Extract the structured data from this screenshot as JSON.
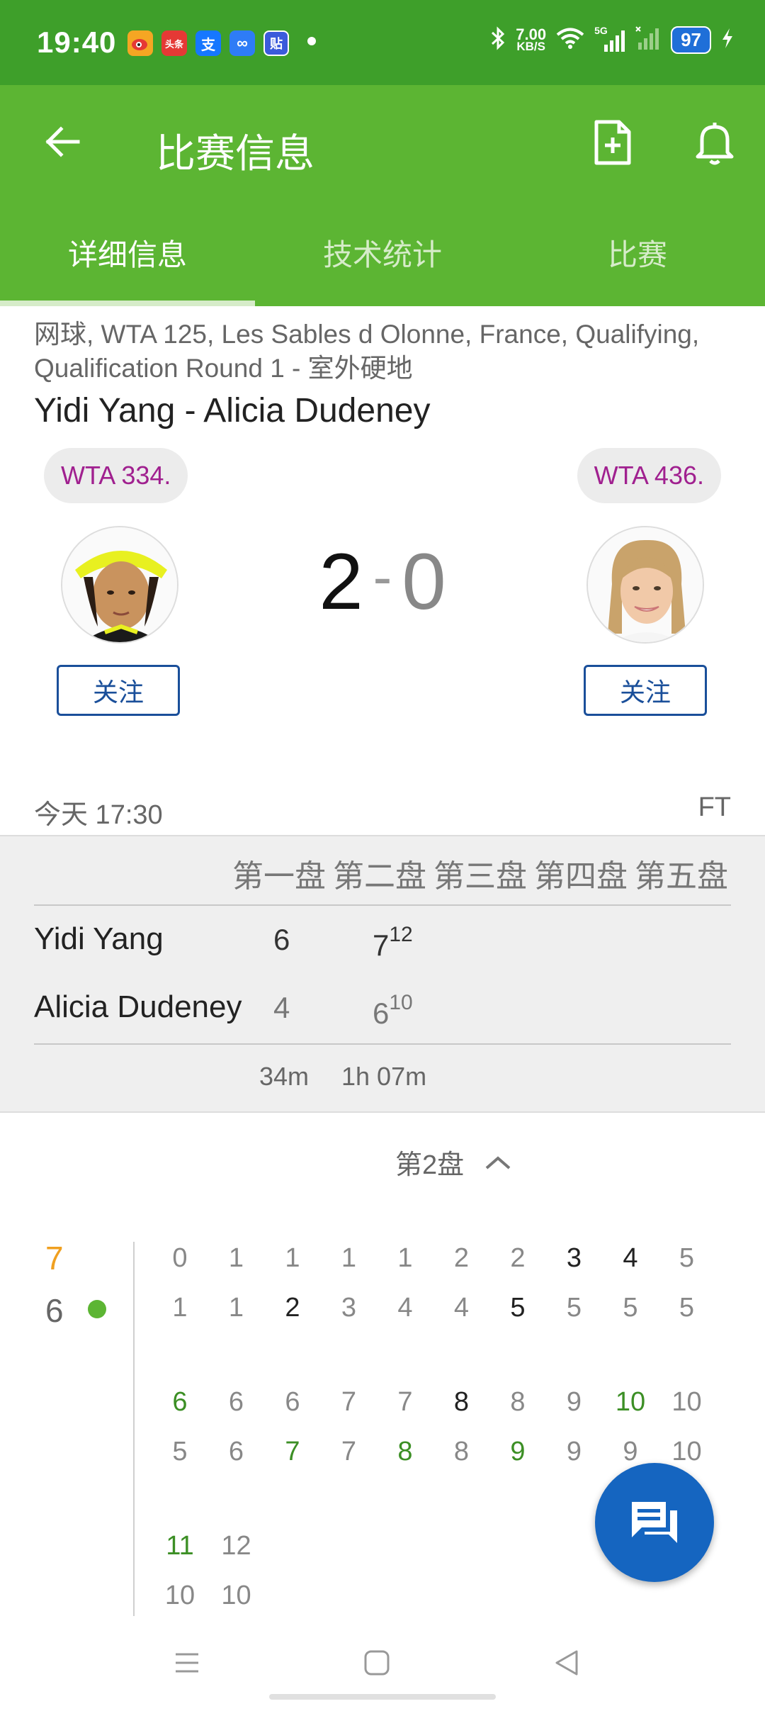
{
  "status_bar": {
    "time": "19:40",
    "net_speed_value": "7.00",
    "net_speed_unit": "KB/S",
    "network": "5G",
    "battery": "97",
    "apps": [
      {
        "name": "weibo-icon",
        "label": "",
        "color": "#f5a623"
      },
      {
        "name": "toutiao-icon",
        "label": "头条",
        "color": "#e53935"
      },
      {
        "name": "alipay-icon",
        "label": "支",
        "color": "#1677ff"
      },
      {
        "name": "baidu-netdisk-icon",
        "label": "∞",
        "color": "#2e7cf6"
      },
      {
        "name": "tieba-icon",
        "label": "贴",
        "color": "#3b5bdb"
      }
    ]
  },
  "app_bar": {
    "title": "比赛信息",
    "back_icon": "arrow-left-icon",
    "actions": [
      "add-document-icon",
      "bell-icon"
    ]
  },
  "tabs": [
    {
      "label": "详细信息",
      "active": true
    },
    {
      "label": "技术统计",
      "active": false
    },
    {
      "label": "比赛",
      "active": false
    }
  ],
  "match": {
    "league": "网球, WTA 125, Les Sables d Olonne, France, Qualifying, Qualification Round 1 - 室外硬地",
    "title": "Yidi Yang - Alicia Dudeney",
    "home": {
      "name": "Yidi Yang",
      "rank": "WTA 334.",
      "follow": "关注"
    },
    "away": {
      "name": "Alicia Dudeney",
      "rank": "WTA 436.",
      "follow": "关注"
    },
    "score_home": "2",
    "score_sep": "-",
    "score_away": "0",
    "datetime": "今天 17:30",
    "status": "FT"
  },
  "sets_table": {
    "headers": [
      "第一盘",
      "第二盘",
      "第三盘",
      "第四盘",
      "第五盘"
    ],
    "rows": [
      {
        "player": "Yidi Yang",
        "set1": "6",
        "set2": "7",
        "set2_tb": "12"
      },
      {
        "player": "Alicia Dudeney",
        "set1": "4",
        "set2": "6",
        "set2_tb": "10"
      }
    ],
    "durations": [
      "34m",
      "1h 07m"
    ]
  },
  "set_detail": {
    "label": "第2盘",
    "chevron": "chevron-up-icon",
    "home_games": "7",
    "away_games": "6",
    "home_color": "#f0a020",
    "serve_color": "#5cb533",
    "progression": [
      {
        "home": [
          "0",
          "1",
          "1",
          "1",
          "1",
          "2",
          "2",
          "3",
          "4",
          "5"
        ],
        "away": [
          "1",
          "1",
          "2",
          "3",
          "4",
          "4",
          "5",
          "5",
          "5",
          "5"
        ]
      },
      {
        "home": [
          "6",
          "6",
          "6",
          "7",
          "7",
          "8",
          "8",
          "9",
          "10",
          "10"
        ],
        "away": [
          "5",
          "6",
          "7",
          "7",
          "8",
          "8",
          "9",
          "9",
          "9",
          "10"
        ]
      },
      {
        "home": [
          "11",
          "12"
        ],
        "away": [
          "10",
          "10"
        ]
      }
    ]
  },
  "fab": {
    "icon": "chat-icon",
    "color": "#1565c0"
  },
  "nav_bar": {
    "buttons": [
      "menu-icon",
      "home-square-icon",
      "back-triangle-icon"
    ]
  }
}
